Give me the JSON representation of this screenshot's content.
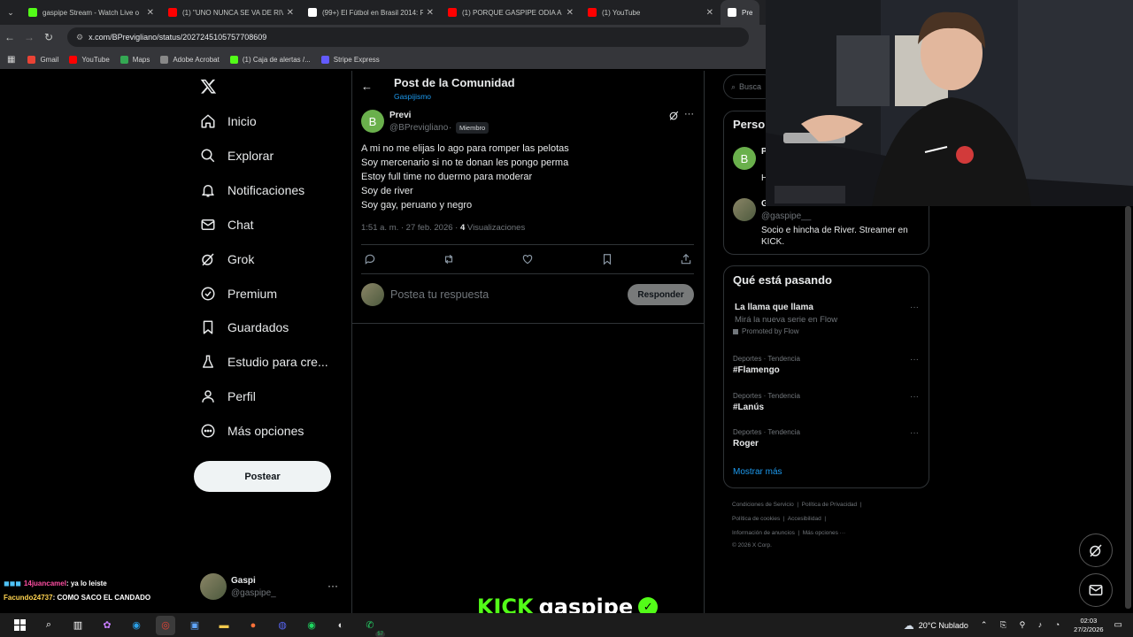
{
  "browser": {
    "tabs": [
      {
        "title": "gaspipe Stream - Watch Live o",
        "icon": "kick-icon",
        "color": "#53fc18"
      },
      {
        "title": "(1) \"UNO NUNCA SE VA DE RIV",
        "icon": "youtube-icon",
        "color": "#ff0000"
      },
      {
        "title": "(99+) El Fútbol en Brasil 2014: R",
        "icon": "tiktok-icon",
        "color": "#ffffff"
      },
      {
        "title": "(1) PORQUE GASPIPE ODIA A P",
        "icon": "youtube-icon",
        "color": "#ff0000"
      },
      {
        "title": "(1) YouTube",
        "icon": "youtube-icon",
        "color": "#ff0000"
      },
      {
        "title": "Previ e",
        "icon": "x-icon",
        "color": "#ffffff"
      }
    ],
    "url": "x.com/BPrevigliano/status/2027245105757708609",
    "bookmarks": [
      {
        "label": "Gmail",
        "color": "#ea4335"
      },
      {
        "label": "YouTube",
        "color": "#ff0000"
      },
      {
        "label": "Maps",
        "color": "#34a853"
      },
      {
        "label": "Adobe Acrobat",
        "color": "#888888"
      },
      {
        "label": "(1) Caja de alertas /...",
        "color": "#53fc18"
      },
      {
        "label": "Stripe Express",
        "color": "#635bff"
      }
    ]
  },
  "sidebar": {
    "items": [
      {
        "label": "Inicio",
        "icon": "home-icon"
      },
      {
        "label": "Explorar",
        "icon": "search-icon"
      },
      {
        "label": "Notificaciones",
        "icon": "bell-icon"
      },
      {
        "label": "Chat",
        "icon": "mail-icon"
      },
      {
        "label": "Grok",
        "icon": "grok-icon"
      },
      {
        "label": "Premium",
        "icon": "verified-icon"
      },
      {
        "label": "Guardados",
        "icon": "bookmark-icon"
      },
      {
        "label": "Estudio para cre...",
        "icon": "flask-icon"
      },
      {
        "label": "Perfil",
        "icon": "person-icon"
      },
      {
        "label": "Más opciones",
        "icon": "more-circle-icon"
      }
    ],
    "post_button": "Postear",
    "account": {
      "name": "Gaspi",
      "handle": "@gaspipe_"
    }
  },
  "feed": {
    "title": "Post de la Comunidad",
    "community": "Gaspijismo",
    "post": {
      "avatar_letter": "B",
      "author": "Previ",
      "handle": "@BPrevigliano",
      "badge": "Miembro",
      "lines": [
        "A mi no me elijas lo ago para romper las pelotas",
        "Soy mercenario si no te donan les pongo perma",
        "Estoy full time no duermo para moderar",
        "Soy de river",
        "Soy gay, peruano y negro"
      ],
      "time": "1:51 a. m. · 27 feb. 2026 · ",
      "views_count": "4",
      "views_label": " Visualizaciones"
    },
    "reply_placeholder": "Postea tu respuesta",
    "reply_button": "Responder"
  },
  "right": {
    "search_placeholder": "Busca",
    "people_title": "Perso",
    "person1": {
      "letter": "B",
      "name": "P",
      "line": "H"
    },
    "person2": {
      "name": "G",
      "handle": "@gaspipe__",
      "bio": "Socio e hincha de River. Streamer en KICK."
    },
    "trending_title": "Qué está pasando",
    "promo": {
      "name": "La llama que llama",
      "desc": "Mirá la nueva serie en Flow",
      "promoted": "Promoted by Flow"
    },
    "trends": [
      {
        "cat": "Deportes · Tendencia",
        "name": "#Flamengo"
      },
      {
        "cat": "Deportes · Tendencia",
        "name": "#Lanús"
      },
      {
        "cat": "Deportes · Tendencia",
        "name": "Roger"
      }
    ],
    "show_more": "Mostrar más",
    "footer": {
      "l1a": "Condiciones de Servicio",
      "l1b": "Política de Privacidad",
      "l2a": "Política de cookies",
      "l2b": "Accesibilidad",
      "l3a": "Información de anuncios",
      "l3b": "Más opciones ···",
      "copy": "© 2026 X Corp."
    }
  },
  "stream_overlay": {
    "chat": [
      {
        "user": "14juancamel",
        "msg": ": ya lo leiste",
        "user_color": "#ff4fa3"
      },
      {
        "user": "Facundo24737",
        "msg": ": COMO SACO EL CANDADO",
        "user_color": "#ffd34f"
      }
    ],
    "kick_brand": "KICK",
    "channel": "gaspipe"
  },
  "taskbar": {
    "weather": "20°C  Nublado",
    "time": "02:03",
    "date": "27/2/2026",
    "badge": "57"
  }
}
